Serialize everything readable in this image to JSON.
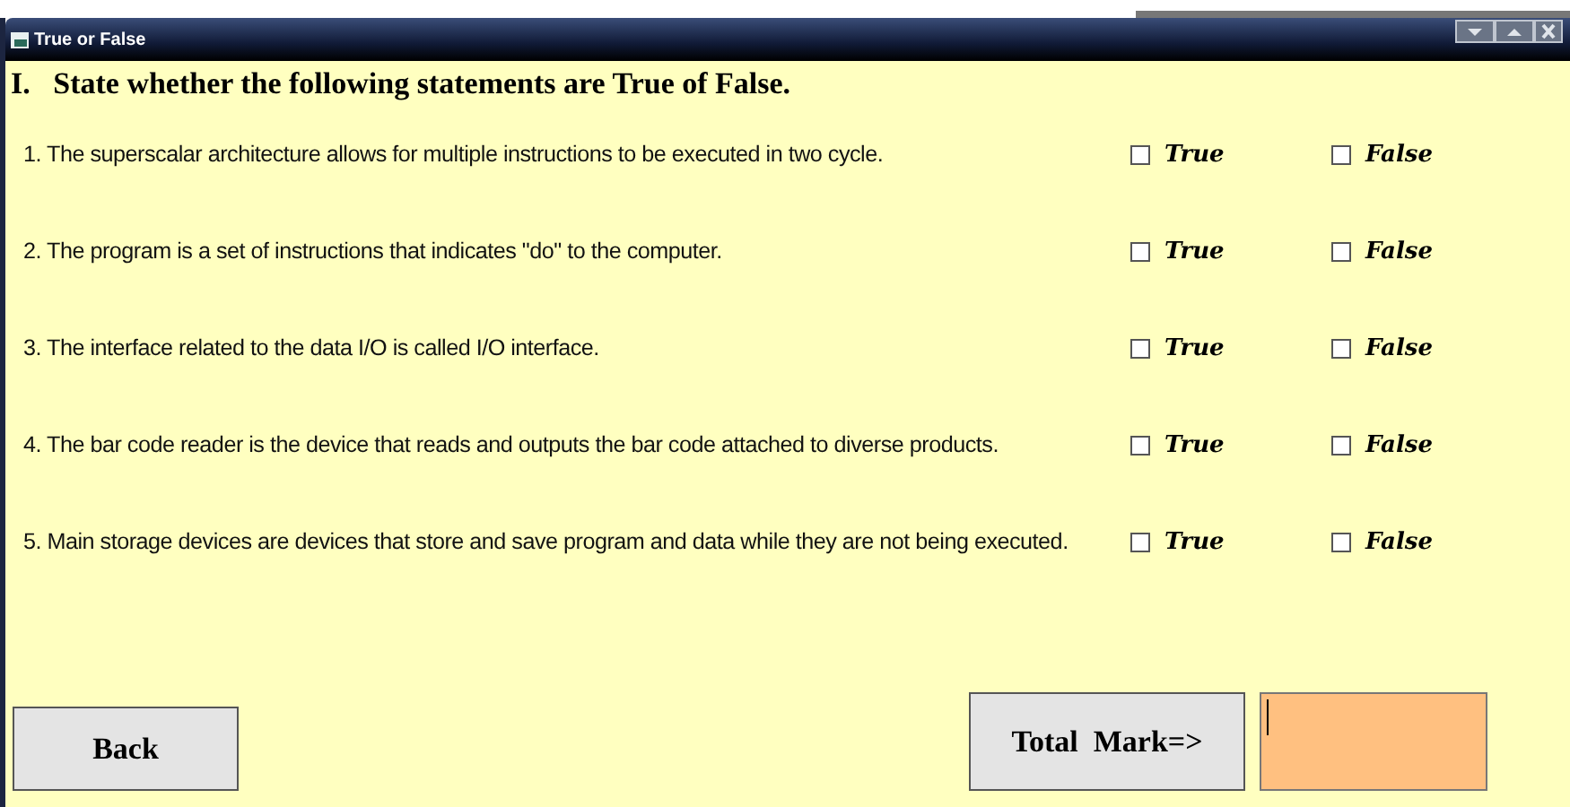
{
  "window": {
    "title": "True or False"
  },
  "heading": "I.   State whether the following statements are True of False.",
  "questions": [
    {
      "text": "1. The superscalar architecture allows for multiple instructions to be executed in two cycle.",
      "options": [
        {
          "label": "True",
          "checked": false
        },
        {
          "label": "False",
          "checked": false
        }
      ]
    },
    {
      "text": "2. The program is a set of instructions that indicates \"do\" to the computer.",
      "options": [
        {
          "label": "True",
          "checked": false
        },
        {
          "label": "False",
          "checked": false
        }
      ]
    },
    {
      "text": "3. The interface related to the data I/O is called I/O interface.",
      "options": [
        {
          "label": "True",
          "checked": false
        },
        {
          "label": "False",
          "checked": false
        }
      ]
    },
    {
      "text": "4. The bar code reader is the device that reads and outputs the bar code attached to diverse products.",
      "options": [
        {
          "label": "True",
          "checked": false
        },
        {
          "label": "False",
          "checked": false
        }
      ]
    },
    {
      "text": "5. Main storage devices are devices that store and save program and data while they are not being executed.",
      "options": [
        {
          "label": "True",
          "checked": false
        },
        {
          "label": "False",
          "checked": false
        }
      ]
    }
  ],
  "back_button": "Back",
  "total_button": "Total  Mark=>"
}
